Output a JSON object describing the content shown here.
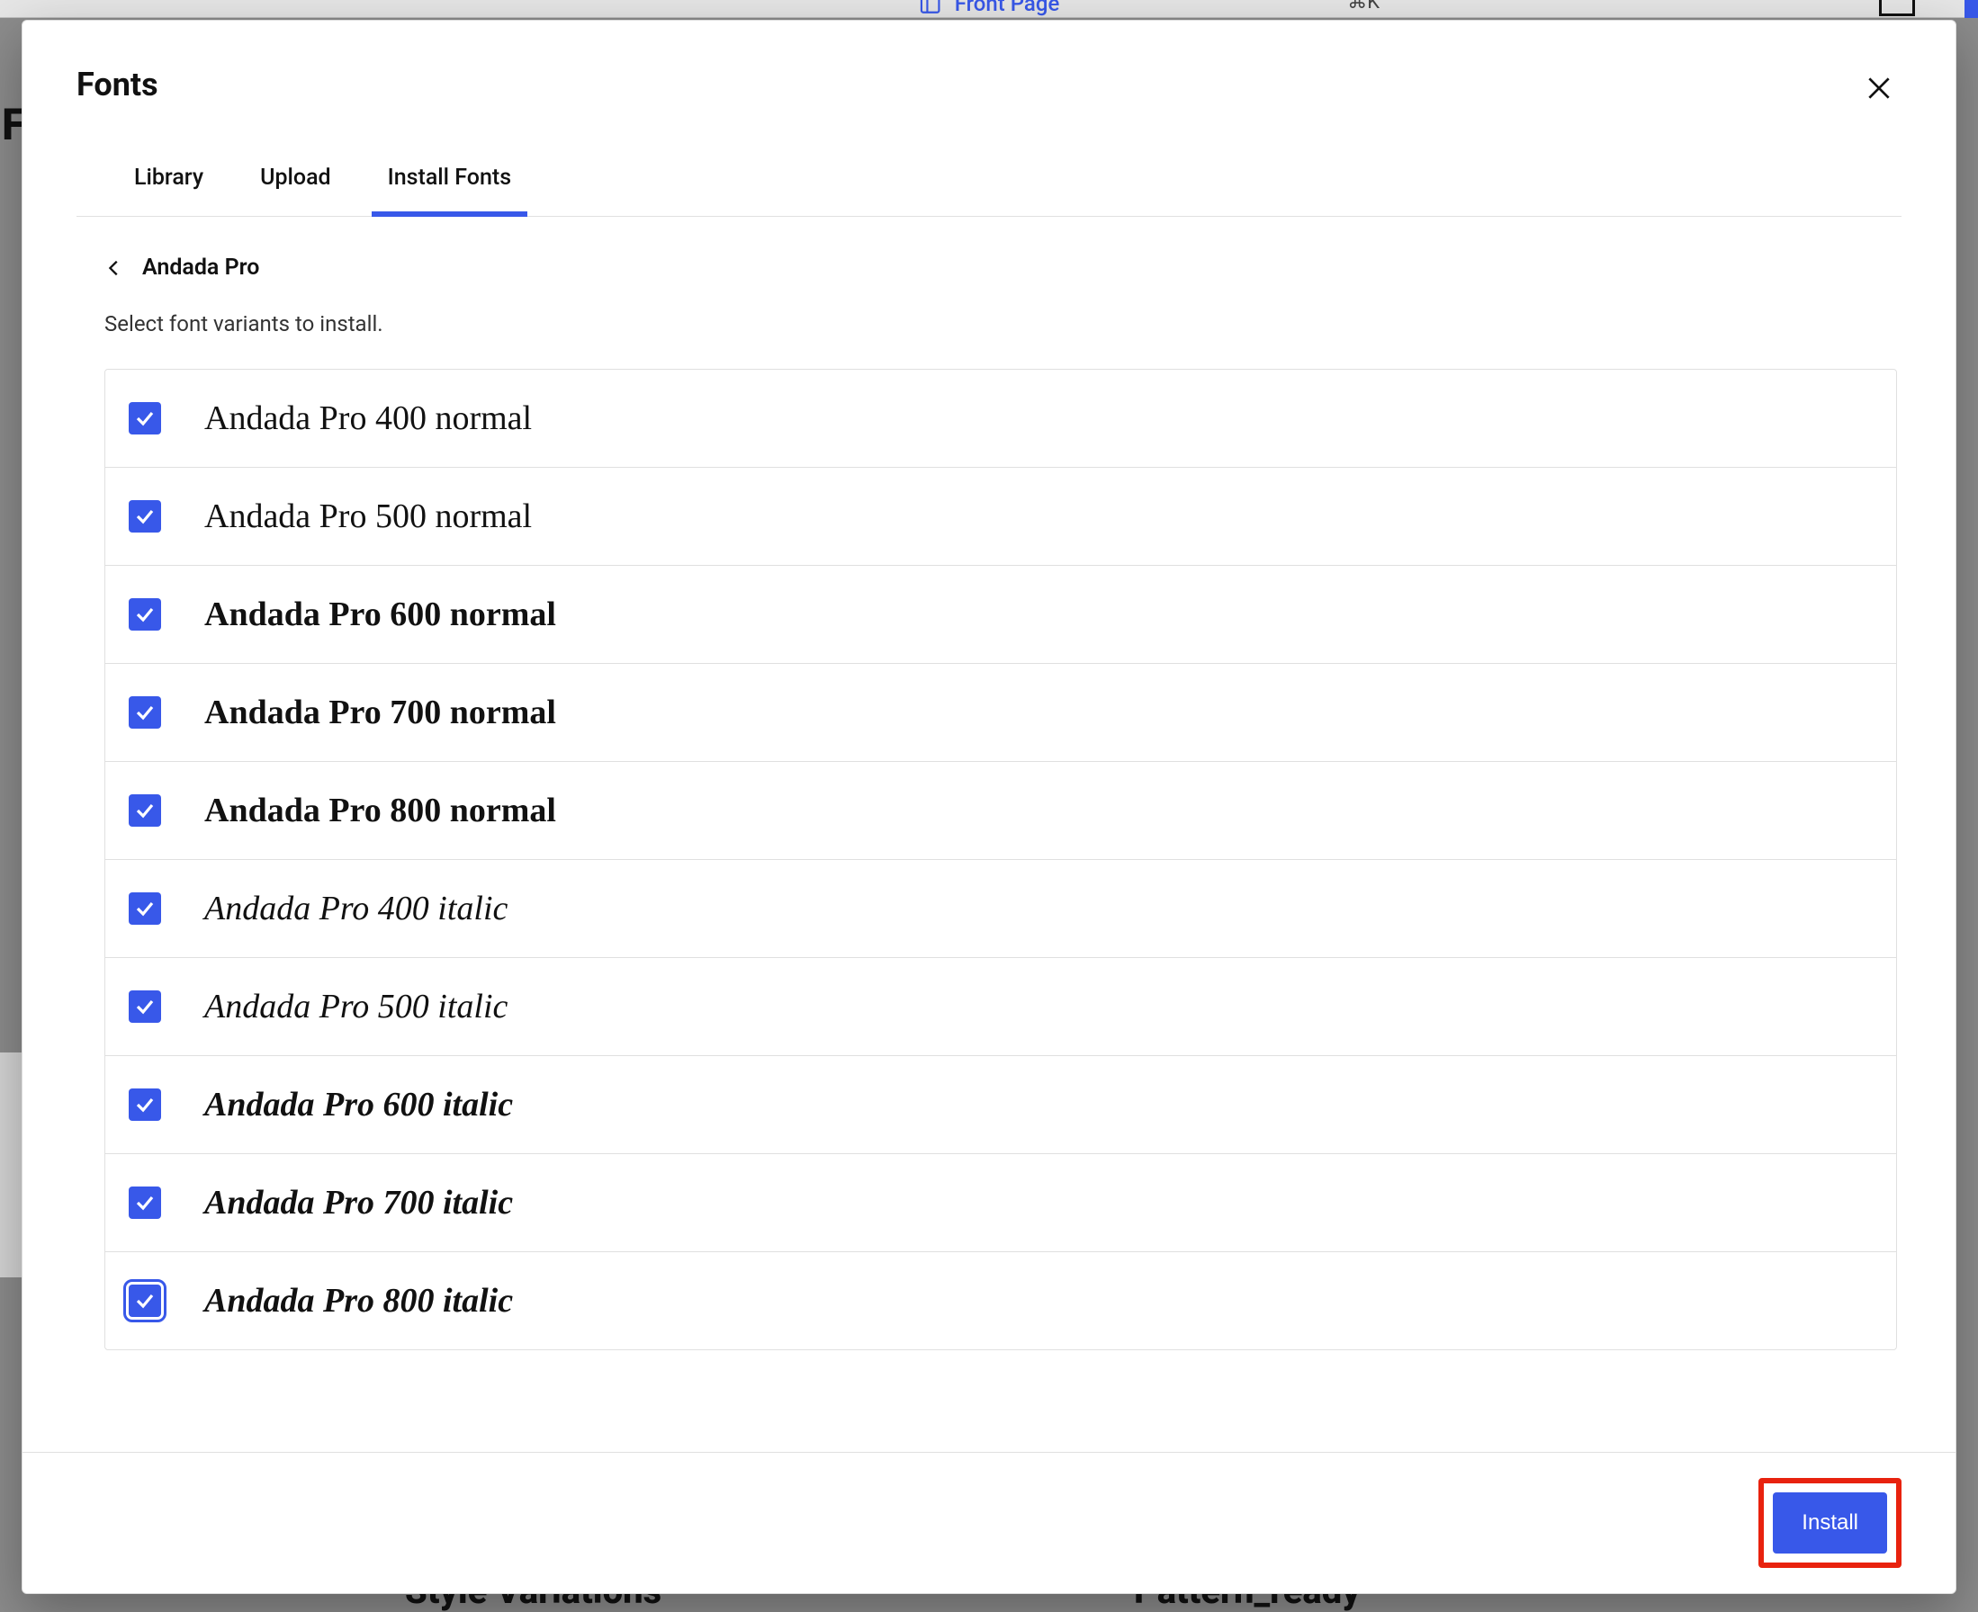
{
  "background": {
    "top_center_label": "Front Page",
    "top_kbd": "⌘K",
    "left_letter": "F",
    "bottom_left": "Style Variations",
    "bottom_right": "Pattern_ready"
  },
  "modal": {
    "title": "Fonts",
    "tabs": {
      "library": "Library",
      "upload": "Upload",
      "install_fonts": "Install Fonts"
    },
    "active_tab": "install_fonts",
    "breadcrumb": "Andada Pro",
    "instruction": "Select font variants to install.",
    "variants": [
      {
        "label": "Andada Pro 400 normal",
        "weight": "400",
        "style": "normal",
        "checked": true,
        "focused": false
      },
      {
        "label": "Andada Pro 500 normal",
        "weight": "500",
        "style": "normal",
        "checked": true,
        "focused": false
      },
      {
        "label": "Andada Pro 600 normal",
        "weight": "600",
        "style": "normal",
        "checked": true,
        "focused": false
      },
      {
        "label": "Andada Pro 700 normal",
        "weight": "700",
        "style": "normal",
        "checked": true,
        "focused": false
      },
      {
        "label": "Andada Pro 800 normal",
        "weight": "800",
        "style": "normal",
        "checked": true,
        "focused": false
      },
      {
        "label": "Andada Pro 400 italic",
        "weight": "400",
        "style": "italic",
        "checked": true,
        "focused": false
      },
      {
        "label": "Andada Pro 500 italic",
        "weight": "500",
        "style": "italic",
        "checked": true,
        "focused": false
      },
      {
        "label": "Andada Pro 600 italic",
        "weight": "600",
        "style": "italic",
        "checked": true,
        "focused": false
      },
      {
        "label": "Andada Pro 700 italic",
        "weight": "700",
        "style": "italic",
        "checked": true,
        "focused": false
      },
      {
        "label": "Andada Pro 800 italic",
        "weight": "800",
        "style": "italic",
        "checked": true,
        "focused": true
      }
    ],
    "install_button": "Install"
  }
}
